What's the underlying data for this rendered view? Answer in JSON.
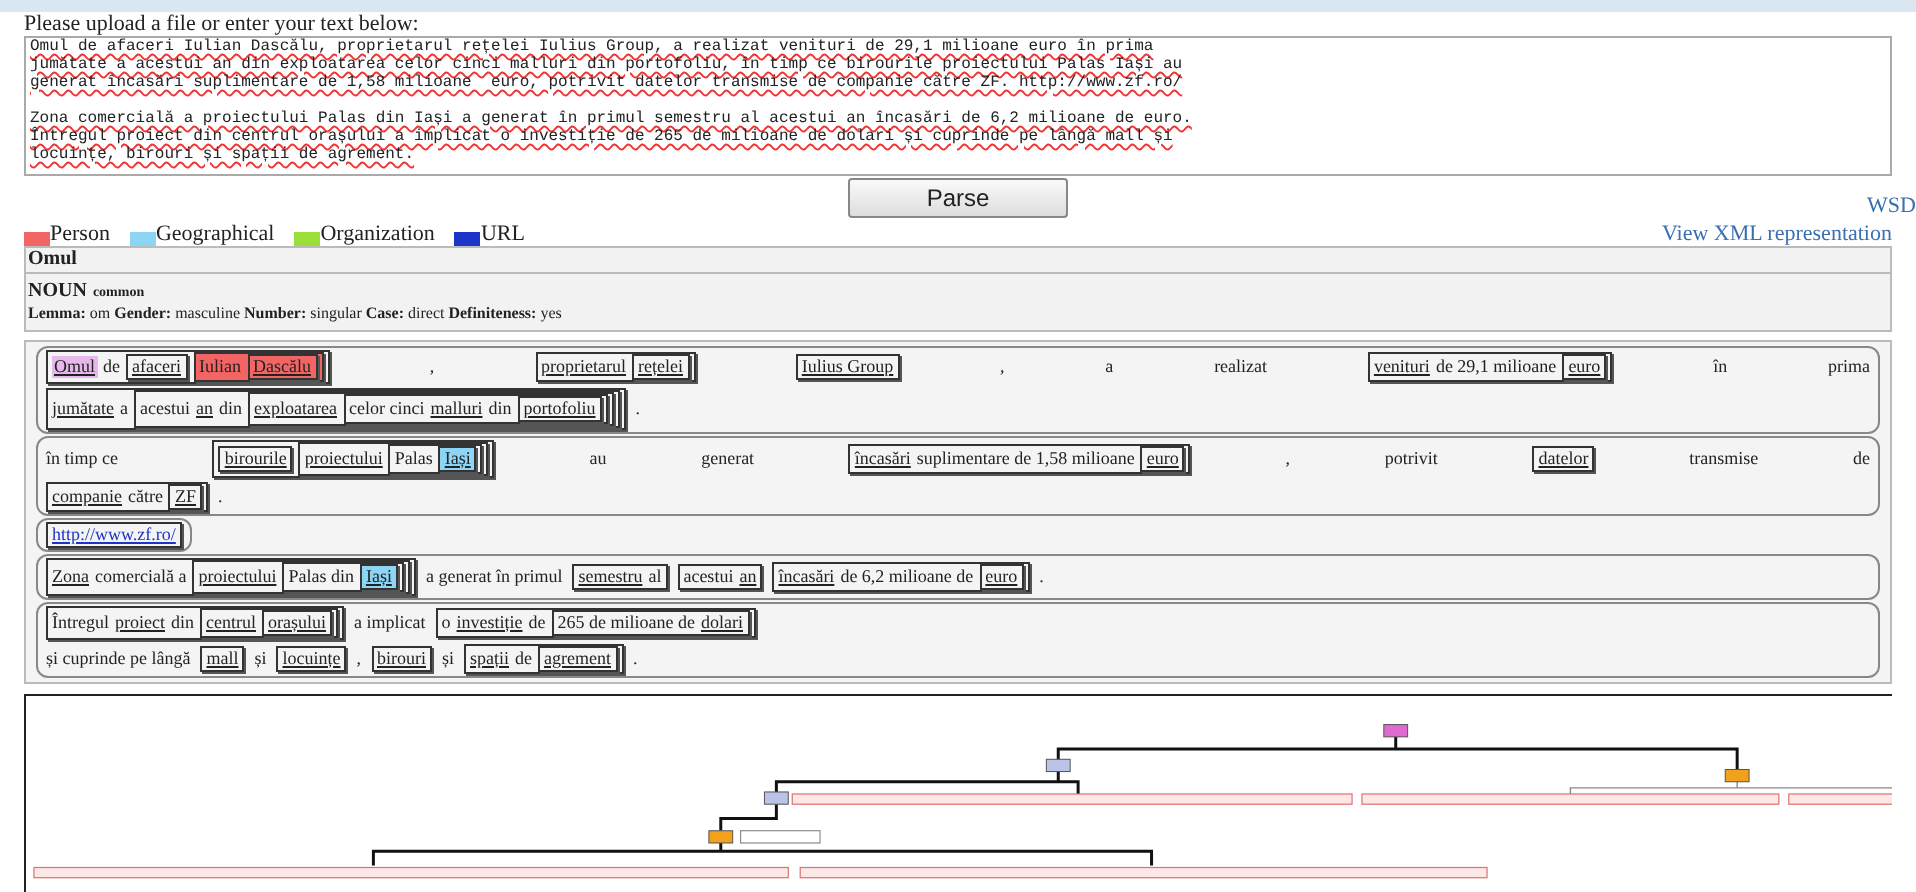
{
  "upload": {
    "label": "Please upload a file or enter your text below:",
    "value": "Omul de afaceri Iulian Dascălu, proprietarul rețelei Iulius Group, a realizat venituri de 29,1 milioane euro în prima\njumătate a acestui an din exploatarea celor cinci malluri din portofoliu, în timp ce birourile proiectului Palas Iași au\ngenerat încasări suplimentare de 1,58 milioane  euro, potrivit datelor transmise de companie către ZF. http://www.zf.ro/\n\nZona comercială a proiectului Palas din Iași a generat în primul semestru al acestui an încasări de 6,2 milioane de euro.\nÎntregul proiect din centrul orașului a implicat o investiție de 265 de milioane de dolari și cuprinde pe lângă mall și\nlocuințe, birouri și spații de agrement."
  },
  "parse_button": "Parse",
  "wsdl_link": "WSD",
  "legend": [
    {
      "label": "Person",
      "color": "#f26565"
    },
    {
      "label": "Geographical",
      "color": "#8dd5f5"
    },
    {
      "label": "Organization",
      "color": "#9be03a"
    },
    {
      "label": "URL",
      "color": "#1c34c8"
    }
  ],
  "xml_link": "View XML representation",
  "info": {
    "word": "Omul",
    "pos": "NOUN",
    "subtype": "common",
    "features": "**Lemma:** om **Gender:** masculine **Number:** singular **Case:** direct **Definiteness:** yes"
  },
  "sentences": [
    {
      "lines": [
        [
          {
            "kind": "box",
            "items": [
              {
                "kind": "word",
                "w": "Omul",
                "underlined": true,
                "selected": true
              },
              {
                "kind": "word",
                "w": "de",
                "underlined": false,
                "selected": false
              },
              {
                "kind": "box",
                "items": [
                  {
                    "kind": "word",
                    "w": "afaceri",
                    "underlined": true,
                    "selected": false
                  }
                ]
              },
              {
                "kind": "box",
                "color": "#f26565",
                "items": [
                  {
                    "kind": "word",
                    "w": "Iulian",
                    "underlined": false,
                    "selected": false
                  },
                  {
                    "kind": "box",
                    "color": "#f26565",
                    "items": [
                      {
                        "kind": "word",
                        "w": "Dascălu",
                        "underlined": true,
                        "selected": false
                      }
                    ]
                  }
                ]
              }
            ]
          },
          {
            "kind": "word",
            "w": ",",
            "underlined": false,
            "selected": false
          },
          {
            "kind": "box",
            "items": [
              {
                "kind": "word",
                "w": "proprietarul",
                "underlined": true,
                "selected": false
              },
              {
                "kind": "box",
                "items": [
                  {
                    "kind": "word",
                    "w": "rețelei",
                    "underlined": true,
                    "selected": false
                  }
                ]
              }
            ]
          },
          {
            "kind": "box",
            "items": [
              {
                "kind": "word",
                "w": "Iulius Group",
                "underlined": true,
                "selected": false
              }
            ]
          },
          {
            "kind": "word",
            "w": ",",
            "underlined": false,
            "selected": false
          },
          {
            "kind": "word",
            "w": "a",
            "underlined": false,
            "selected": false
          },
          {
            "kind": "word",
            "w": "realizat",
            "underlined": false,
            "selected": false
          },
          {
            "kind": "box",
            "items": [
              {
                "kind": "word",
                "w": "venituri",
                "underlined": true,
                "selected": false
              },
              {
                "kind": "word",
                "w": "de 29,1 milioane",
                "underlined": false,
                "selected": false
              },
              {
                "kind": "box",
                "items": [
                  {
                    "kind": "word",
                    "w": "euro",
                    "underlined": true,
                    "selected": false
                  }
                ]
              }
            ]
          },
          {
            "kind": "word",
            "w": "în",
            "underlined": false,
            "selected": false
          },
          {
            "kind": "word",
            "w": "prima",
            "underlined": false,
            "selected": false
          }
        ],
        [
          {
            "kind": "box",
            "items": [
              {
                "kind": "word",
                "w": "jumătate",
                "underlined": true,
                "selected": false
              },
              {
                "kind": "word",
                "w": "a",
                "underlined": false,
                "selected": false
              },
              {
                "kind": "box",
                "items": [
                  {
                    "kind": "word",
                    "w": "acestui",
                    "underlined": false,
                    "selected": false
                  },
                  {
                    "kind": "word",
                    "w": "an",
                    "underlined": true,
                    "selected": false
                  },
                  {
                    "kind": "word",
                    "w": "din",
                    "underlined": false,
                    "selected": false
                  },
                  {
                    "kind": "box",
                    "items": [
                      {
                        "kind": "word",
                        "w": "exploatarea",
                        "underlined": true,
                        "selected": false
                      },
                      {
                        "kind": "box",
                        "items": [
                          {
                            "kind": "word",
                            "w": "celor cinci",
                            "underlined": false,
                            "selected": false
                          },
                          {
                            "kind": "word",
                            "w": "malluri",
                            "underlined": true,
                            "selected": false
                          },
                          {
                            "kind": "word",
                            "w": "din",
                            "underlined": false,
                            "selected": false
                          },
                          {
                            "kind": "box",
                            "items": [
                              {
                                "kind": "word",
                                "w": "portofoliu",
                                "underlined": true,
                                "selected": false
                              }
                            ]
                          }
                        ]
                      }
                    ]
                  }
                ]
              }
            ]
          },
          {
            "kind": "word",
            "w": ".",
            "underlined": false,
            "selected": false
          }
        ]
      ]
    },
    {
      "lines": [
        [
          {
            "kind": "word",
            "w": "în timp ce",
            "underlined": false,
            "selected": false
          },
          {
            "kind": "box",
            "items": [
              {
                "kind": "box",
                "items": [
                  {
                    "kind": "word",
                    "w": "birourile",
                    "underlined": true,
                    "selected": false
                  }
                ]
              },
              {
                "kind": "box",
                "items": [
                  {
                    "kind": "word",
                    "w": "proiectului",
                    "underlined": true,
                    "selected": false
                  },
                  {
                    "kind": "box",
                    "items": [
                      {
                        "kind": "word",
                        "w": "Palas",
                        "underlined": false,
                        "selected": false
                      },
                      {
                        "kind": "box",
                        "color": "#8dd5f5",
                        "items": [
                          {
                            "kind": "word",
                            "w": "Iași",
                            "underlined": true,
                            "selected": false
                          }
                        ]
                      }
                    ]
                  }
                ]
              }
            ]
          },
          {
            "kind": "word",
            "w": "au",
            "underlined": false,
            "selected": false
          },
          {
            "kind": "word",
            "w": "generat",
            "underlined": false,
            "selected": false
          },
          {
            "kind": "box",
            "items": [
              {
                "kind": "word",
                "w": "încasări",
                "underlined": true,
                "selected": false
              },
              {
                "kind": "word",
                "w": "suplimentare de 1,58 milioane",
                "underlined": false,
                "selected": false
              },
              {
                "kind": "box",
                "items": [
                  {
                    "kind": "word",
                    "w": "euro",
                    "underlined": true,
                    "selected": false
                  }
                ]
              }
            ]
          },
          {
            "kind": "word",
            "w": ",",
            "underlined": false,
            "selected": false
          },
          {
            "kind": "word",
            "w": "potrivit",
            "underlined": false,
            "selected": false
          },
          {
            "kind": "box",
            "items": [
              {
                "kind": "word",
                "w": "datelor",
                "underlined": true,
                "selected": false
              }
            ]
          },
          {
            "kind": "word",
            "w": "transmise",
            "underlined": false,
            "selected": false
          },
          {
            "kind": "word",
            "w": "de",
            "underlined": false,
            "selected": false
          }
        ],
        [
          {
            "kind": "box",
            "items": [
              {
                "kind": "word",
                "w": "companie",
                "underlined": true,
                "selected": false
              },
              {
                "kind": "word",
                "w": "către",
                "underlined": false,
                "selected": false
              },
              {
                "kind": "box",
                "items": [
                  {
                    "kind": "word",
                    "w": "ZF",
                    "underlined": true,
                    "selected": false
                  }
                ]
              }
            ]
          },
          {
            "kind": "word",
            "w": ".",
            "underlined": false,
            "selected": false
          }
        ]
      ]
    },
    {
      "lines": [
        [
          {
            "kind": "box",
            "items": [
              {
                "kind": "link",
                "w": "http://www.zf.ro/"
              }
            ]
          }
        ]
      ]
    },
    {
      "lines": [
        [
          {
            "kind": "box",
            "items": [
              {
                "kind": "word",
                "w": "Zona",
                "underlined": true,
                "selected": false
              },
              {
                "kind": "word",
                "w": "comercială a",
                "underlined": false,
                "selected": false
              },
              {
                "kind": "box",
                "items": [
                  {
                    "kind": "word",
                    "w": "proiectului",
                    "underlined": true,
                    "selected": false
                  },
                  {
                    "kind": "box",
                    "items": [
                      {
                        "kind": "word",
                        "w": "Palas din",
                        "underlined": false,
                        "selected": false
                      },
                      {
                        "kind": "box",
                        "color": "#8dd5f5",
                        "items": [
                          {
                            "kind": "word",
                            "w": "Iași",
                            "underlined": true,
                            "selected": false
                          }
                        ]
                      }
                    ]
                  }
                ]
              }
            ]
          },
          {
            "kind": "word",
            "w": "a generat în primul",
            "underlined": false,
            "selected": false
          },
          {
            "kind": "box",
            "items": [
              {
                "kind": "word",
                "w": "semestru",
                "underlined": true,
                "selected": false
              },
              {
                "kind": "word",
                "w": "al",
                "underlined": false,
                "selected": false
              }
            ]
          },
          {
            "kind": "box",
            "items": [
              {
                "kind": "word",
                "w": "acestui",
                "underlined": false,
                "selected": false
              },
              {
                "kind": "word",
                "w": "an",
                "underlined": true,
                "selected": false
              }
            ]
          },
          {
            "kind": "box",
            "items": [
              {
                "kind": "word",
                "w": "încasări",
                "underlined": true,
                "selected": false
              },
              {
                "kind": "word",
                "w": "de 6,2 milioane de",
                "underlined": false,
                "selected": false
              },
              {
                "kind": "box",
                "items": [
                  {
                    "kind": "word",
                    "w": "euro",
                    "underlined": true,
                    "selected": false
                  }
                ]
              }
            ]
          },
          {
            "kind": "word",
            "w": ".",
            "underlined": false,
            "selected": false
          }
        ]
      ]
    },
    {
      "lines": [
        [
          {
            "kind": "box",
            "items": [
              {
                "kind": "word",
                "w": "Întregul",
                "underlined": false,
                "selected": false
              },
              {
                "kind": "word",
                "w": "proiect",
                "underlined": true,
                "selected": false
              },
              {
                "kind": "word",
                "w": "din",
                "underlined": false,
                "selected": false
              },
              {
                "kind": "box",
                "items": [
                  {
                    "kind": "word",
                    "w": "centrul",
                    "underlined": true,
                    "selected": false
                  },
                  {
                    "kind": "box",
                    "items": [
                      {
                        "kind": "word",
                        "w": "orașului",
                        "underlined": true,
                        "selected": false
                      }
                    ]
                  }
                ]
              }
            ]
          },
          {
            "kind": "word",
            "w": "a implicat",
            "underlined": false,
            "selected": false
          },
          {
            "kind": "box",
            "items": [
              {
                "kind": "word",
                "w": "o",
                "underlined": false,
                "selected": false
              },
              {
                "kind": "word",
                "w": "investiție",
                "underlined": true,
                "selected": false
              },
              {
                "kind": "word",
                "w": "de",
                "underlined": false,
                "selected": false
              },
              {
                "kind": "box",
                "items": [
                  {
                    "kind": "word",
                    "w": "265 de milioane de",
                    "underlined": false,
                    "selected": false
                  },
                  {
                    "kind": "word",
                    "w": "dolari",
                    "underlined": true,
                    "selected": false
                  }
                ]
              }
            ]
          }
        ],
        [
          {
            "kind": "word",
            "w": "și cuprinde pe lângă",
            "underlined": false,
            "selected": false
          },
          {
            "kind": "box",
            "items": [
              {
                "kind": "word",
                "w": "mall",
                "underlined": true,
                "selected": false
              }
            ]
          },
          {
            "kind": "word",
            "w": "și",
            "underlined": false,
            "selected": false
          },
          {
            "kind": "box",
            "items": [
              {
                "kind": "word",
                "w": "locuințe",
                "underlined": true,
                "selected": false
              }
            ]
          },
          {
            "kind": "word",
            "w": ",",
            "underlined": false,
            "selected": false
          },
          {
            "kind": "box",
            "items": [
              {
                "kind": "word",
                "w": "birouri",
                "underlined": true,
                "selected": false
              }
            ]
          },
          {
            "kind": "word",
            "w": "și",
            "underlined": false,
            "selected": false
          },
          {
            "kind": "box",
            "items": [
              {
                "kind": "word",
                "w": "spații",
                "underlined": true,
                "selected": false
              },
              {
                "kind": "word",
                "w": "de",
                "underlined": false,
                "selected": false
              },
              {
                "kind": "box",
                "items": [
                  {
                    "kind": "word",
                    "w": "agrement",
                    "underlined": true,
                    "selected": false
                  }
                ]
              }
            ]
          },
          {
            "kind": "word",
            "w": ".",
            "underlined": false,
            "selected": false
          }
        ]
      ]
    }
  ]
}
